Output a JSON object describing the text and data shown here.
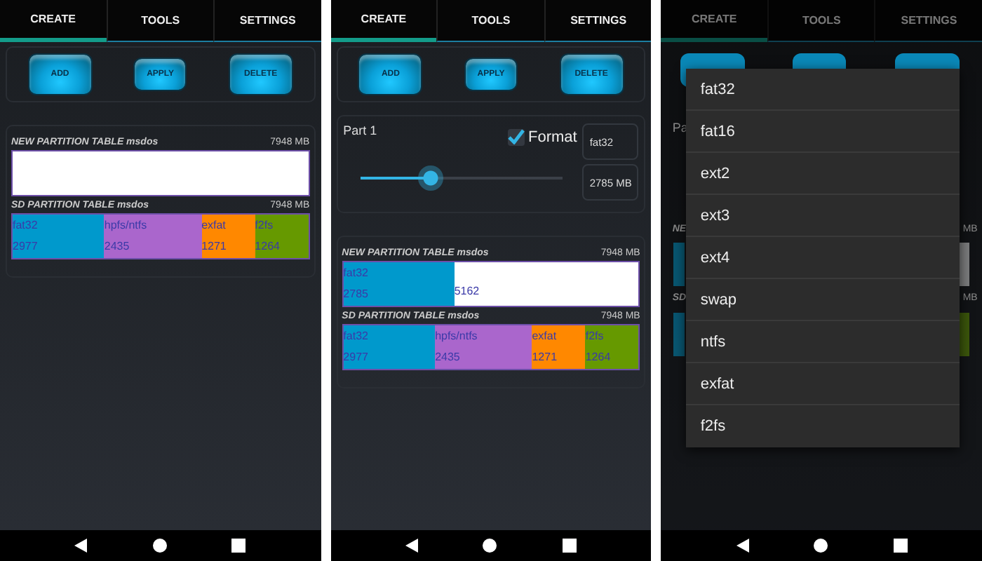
{
  "screens": [
    {
      "kind": "tables",
      "tabs": [
        {
          "label": "CREATE",
          "selected": true
        },
        {
          "label": "TOOLS",
          "selected": false
        },
        {
          "label": "SETTINGS",
          "selected": false
        }
      ],
      "buttons": [
        "ADD",
        "APPLY",
        "DELETE"
      ],
      "tables": [
        {
          "title": "NEW PARTITION TABLE msdos",
          "size": "7948 MB",
          "partitions": [
            {
              "kind": "free",
              "color": "#ffffff"
            }
          ]
        },
        {
          "title": "SD PARTITION TABLE msdos",
          "size": "7948 MB",
          "partitions": [
            {
              "kind": "used",
              "name": "fat32",
              "size": "2977",
              "color": "#0099cc"
            },
            {
              "kind": "used",
              "name": "hpfs/ntfs",
              "size": "2435",
              "color": "#aa66cc"
            },
            {
              "kind": "used",
              "name": "exfat",
              "size": "1271",
              "color": "#ff8800"
            },
            {
              "kind": "used",
              "name": "f2fs",
              "size": "1264",
              "color": "#669900"
            }
          ]
        }
      ]
    },
    {
      "kind": "editor",
      "tabs": [
        {
          "label": "CREATE",
          "selected": true
        },
        {
          "label": "TOOLS",
          "selected": false
        },
        {
          "label": "SETTINGS",
          "selected": false
        }
      ],
      "buttons": [
        "ADD",
        "APPLY",
        "DELETE"
      ],
      "part": {
        "label": "Part 1",
        "format_label": "Format",
        "format_checked": true,
        "filesystem": "fat32",
        "size": "2785 MB",
        "level": 0.35
      },
      "tables": [
        {
          "title": "NEW PARTITION TABLE msdos",
          "size": "7948 MB",
          "partitions": [
            {
              "kind": "used",
              "name": "fat32",
              "size": "2785",
              "color": "#0099cc"
            },
            {
              "kind": "free",
              "size": "5162",
              "color": "#ffffff"
            }
          ]
        },
        {
          "title": "SD PARTITION TABLE msdos",
          "size": "7948 MB",
          "partitions": [
            {
              "kind": "used",
              "name": "fat32",
              "size": "2977",
              "color": "#0099cc"
            },
            {
              "kind": "used",
              "name": "hpfs/ntfs",
              "size": "2435",
              "color": "#aa66cc"
            },
            {
              "kind": "used",
              "name": "exfat",
              "size": "1271",
              "color": "#ff8800"
            },
            {
              "kind": "used",
              "name": "f2fs",
              "size": "1264",
              "color": "#669900"
            }
          ]
        }
      ]
    },
    {
      "kind": "menu",
      "tabs": [
        {
          "label": "CREATE",
          "selected": true
        },
        {
          "label": "TOOLS",
          "selected": false
        },
        {
          "label": "SETTINGS",
          "selected": false
        }
      ],
      "covered_texts": [
        "Pa",
        "NE",
        "MB",
        "SD",
        "MB"
      ],
      "menu": [
        "fat32",
        "fat16",
        "ext2",
        "ext3",
        "ext4",
        "swap",
        "ntfs",
        "exfat",
        "f2fs"
      ]
    }
  ]
}
